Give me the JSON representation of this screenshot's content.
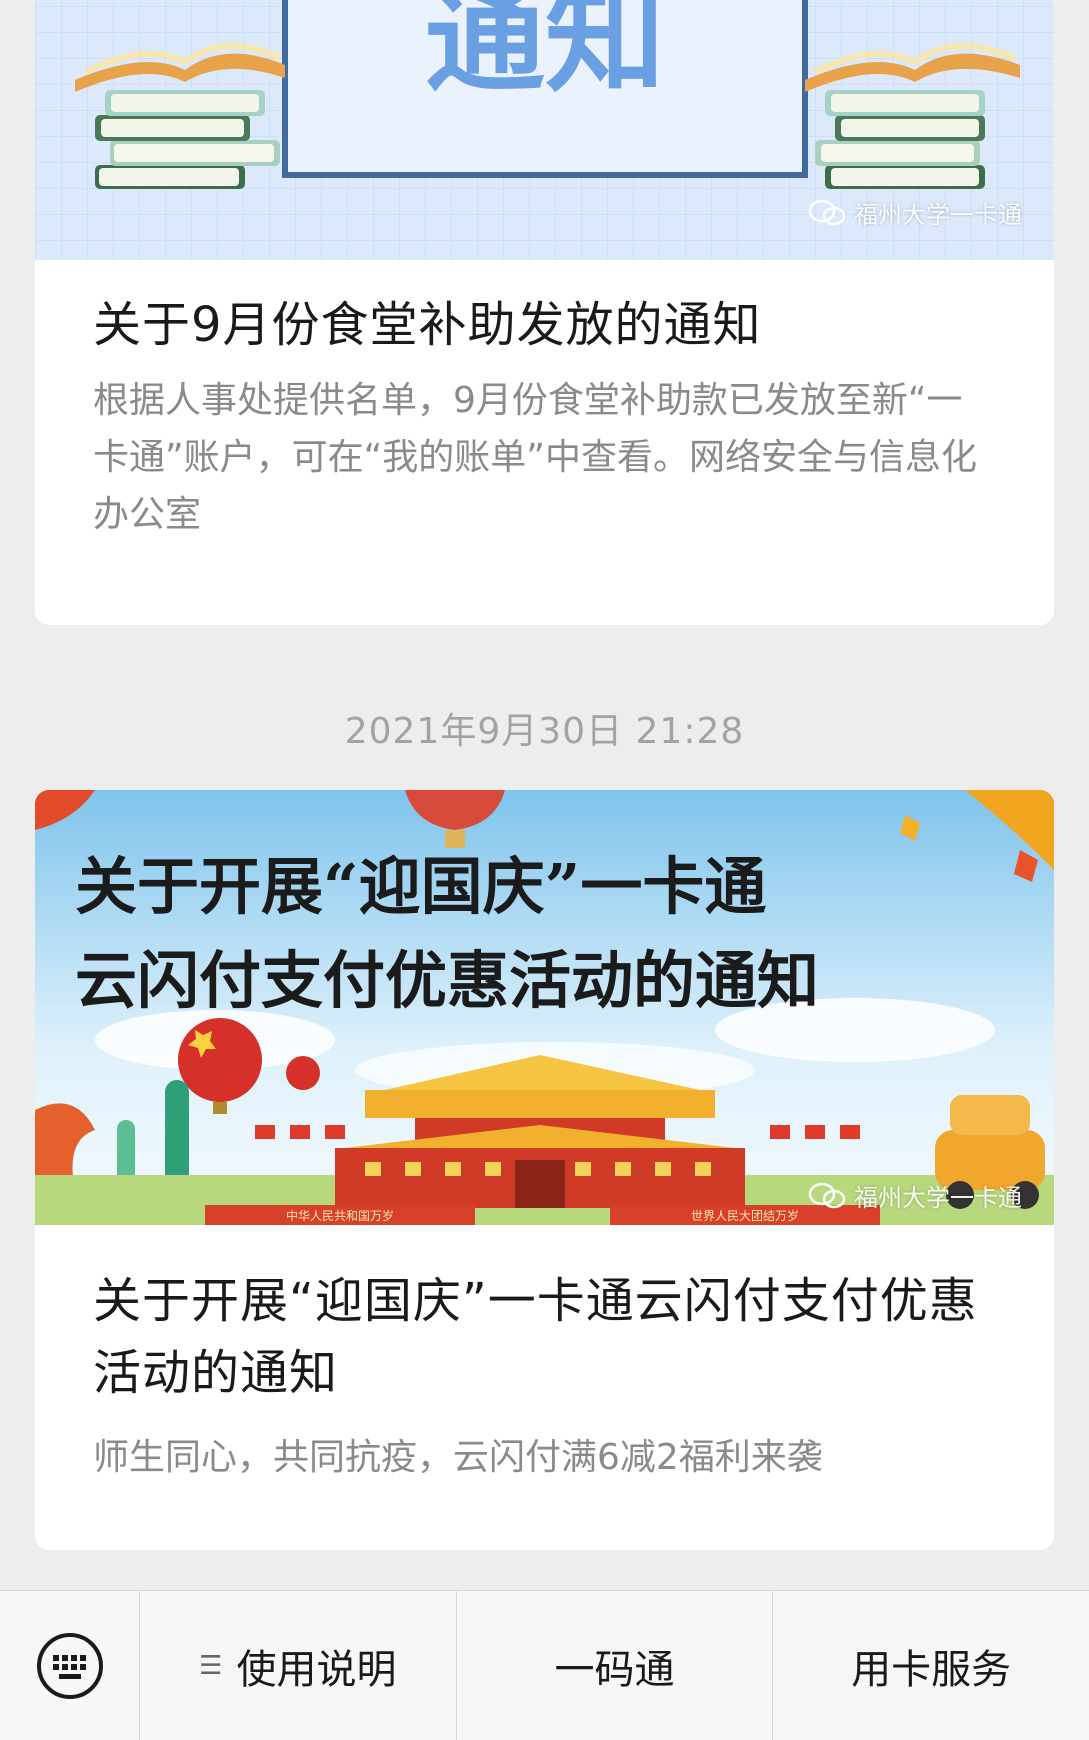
{
  "feed": {
    "card1": {
      "banner_heading": "通知",
      "watermark": "福州大学一卡通",
      "title": "关于9月份食堂补助发放的通知",
      "description": "根据人事处提供名单，9月份食堂补助款已发放至新“一卡通”账户，可在“我的账单”中查看。网络安全与信息化办公室"
    },
    "timestamp": "2021年9月30日 21:28",
    "card2": {
      "banner_line1": "关于开展“迎国庆”一卡通",
      "banner_line2": "云闪付支付优惠活动的通知",
      "banner_sign_left": "中华人民共和国万岁",
      "banner_sign_right": "世界人民大团结万岁",
      "watermark": "福州大学一卡通",
      "title": "关于开展“迎国庆”一卡通云闪付支付优惠活动的通知",
      "description": "师生同心，共同抗疫，云闪付满6减2福利来袭"
    }
  },
  "bottom_bar": {
    "keyboard_icon": "keyboard-icon",
    "menu_icon": "list-icon",
    "items": [
      {
        "label": "使用说明",
        "has_submenu": true
      },
      {
        "label": "一码通",
        "has_submenu": false
      },
      {
        "label": "用卡服务",
        "has_submenu": false
      }
    ]
  },
  "colors": {
    "background": "#ededed",
    "card": "#ffffff",
    "title": "#1a1a1a",
    "description": "#8a8a8a",
    "timestamp": "#a3a3a3",
    "banner_blue": "#dbe9fb",
    "heading_blue": "#6b9fe3"
  }
}
